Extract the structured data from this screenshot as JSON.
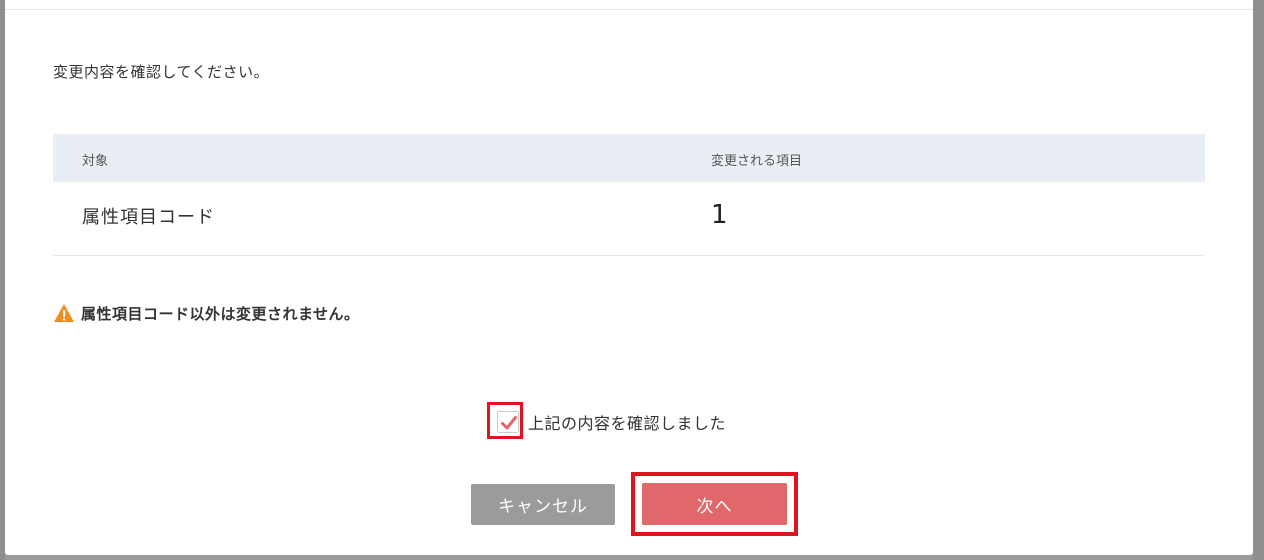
{
  "dialog": {
    "instruction": "変更内容を確認してください。",
    "table": {
      "headers": {
        "target": "対象",
        "changed": "変更される項目"
      },
      "rows": [
        {
          "target": "属性項目コード",
          "changed": "1"
        }
      ]
    },
    "warning": {
      "icon": "warning-triangle-icon",
      "text": "属性項目コード以外は変更されません。"
    },
    "confirm": {
      "checked": true,
      "label": "上記の内容を確認しました"
    },
    "buttons": {
      "cancel": "キャンセル",
      "next": "次へ"
    }
  },
  "colors": {
    "next_button": "#e0676a",
    "cancel_button": "#9b9b9b",
    "header_bg": "#e9eef5",
    "warning": "#f08c1e",
    "highlight_border": "#e0141e"
  }
}
